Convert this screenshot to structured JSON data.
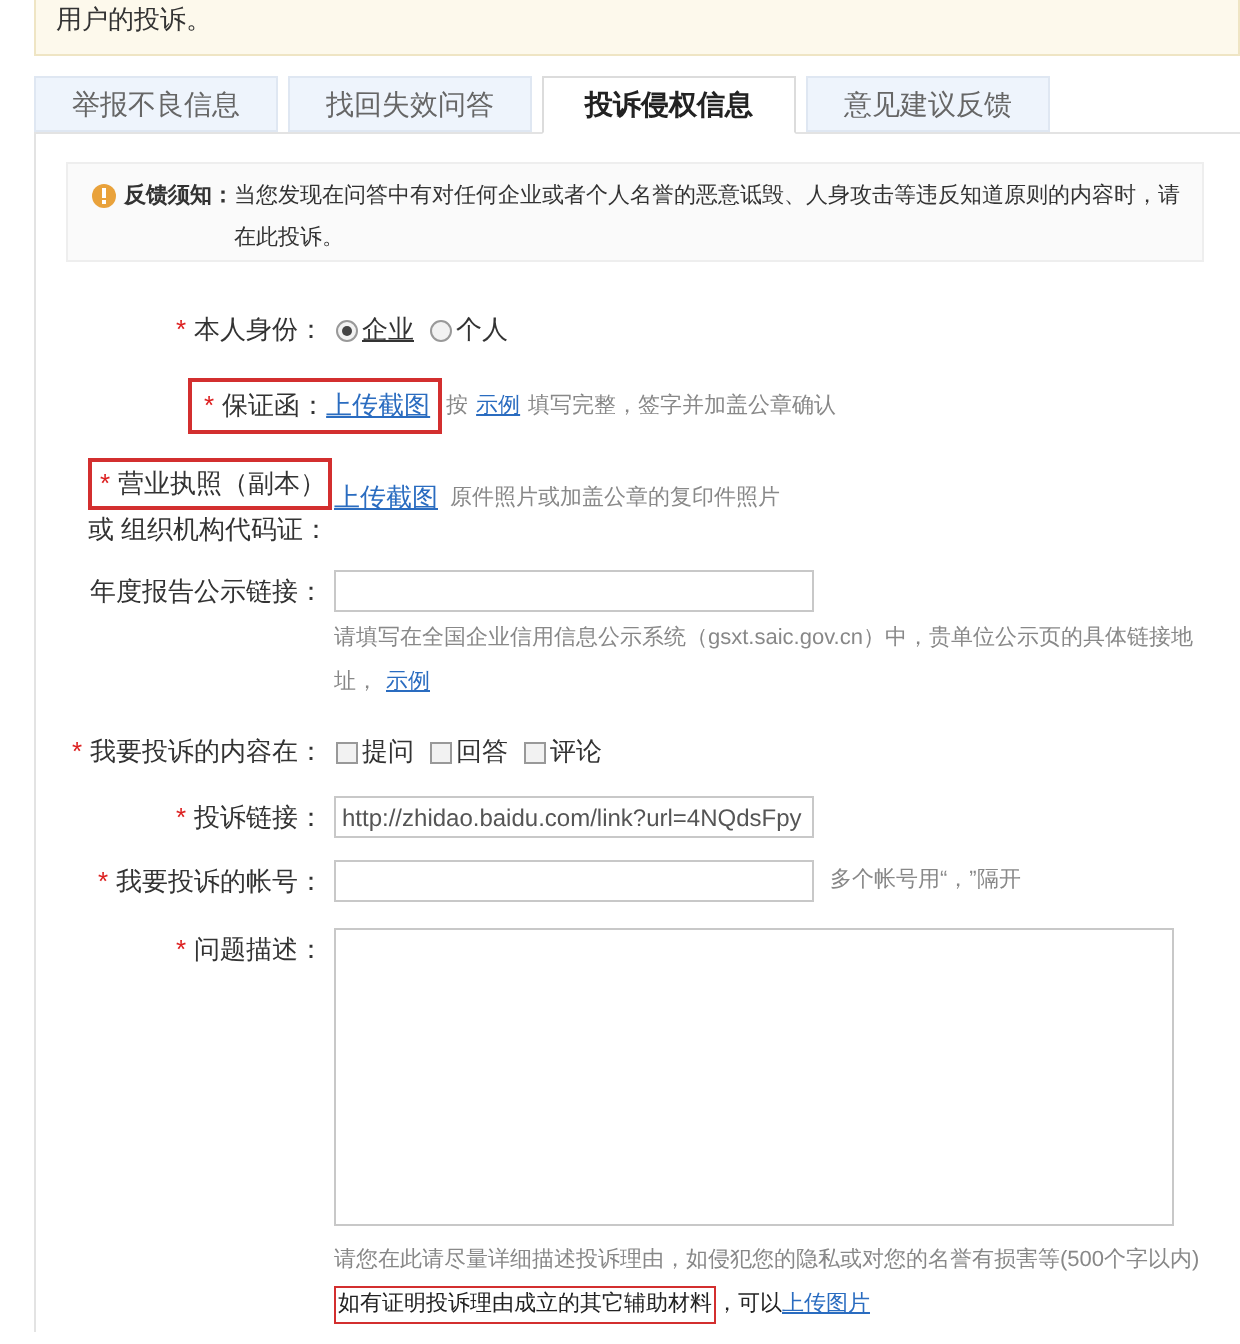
{
  "top_notice": {
    "text": "用户的投诉。"
  },
  "tabs": [
    {
      "label": "举报不良信息",
      "selected": false
    },
    {
      "label": "找回失效问答",
      "selected": false
    },
    {
      "label": "投诉侵权信息",
      "selected": true
    },
    {
      "label": "意见建议反馈",
      "selected": false
    }
  ],
  "notice": {
    "title": "反馈须知：",
    "text": "当您发现在问答中有对任何企业或者个人名誉的恶意诋毁、人身攻击等违反知道原则的内容时，请在此投诉。"
  },
  "rows": [
    {
      "kind": "radio",
      "required_mark": "*",
      "label": "本人身份：",
      "options": [
        {
          "label": "企业",
          "selected": true
        },
        {
          "label": "个人",
          "selected": false
        }
      ]
    },
    {
      "kind": "upload",
      "required_mark": "*",
      "highlighted": true,
      "label": "保证函：",
      "link": "上传截图",
      "hint": [
        {
          "kind": "text",
          "text": "按"
        },
        {
          "kind": "link",
          "text": "示例"
        },
        {
          "kind": "text",
          "text": "填写完整，签字并加盖公章确认"
        }
      ]
    },
    {
      "kind": "upload_two_line",
      "required_mark": "*",
      "highlighted": true,
      "label": "营业执照（副本）",
      "label_2": "或 组织机构代码证：",
      "link": "上传截图",
      "hint": [
        {
          "kind": "text",
          "text": "原件照片或加盖公章的复印件照片"
        }
      ]
    },
    {
      "kind": "text",
      "label": "年度报告公示链接：",
      "value": "",
      "hint": [
        {
          "kind": "text",
          "text": "请填写在全国企业信用信息公示系统（gsxt.saic.gov.cn）中，贵单位公示页的具体链接地址，"
        },
        {
          "kind": "link",
          "text": "示例"
        }
      ]
    },
    {
      "kind": "checkbox",
      "required_mark": "*",
      "label": "我要投诉的内容在：",
      "options": [
        {
          "label": "提问",
          "checked": false
        },
        {
          "label": "回答",
          "checked": false
        },
        {
          "label": "评论",
          "checked": false
        }
      ]
    },
    {
      "kind": "text",
      "required_mark": "*",
      "label": "投诉链接：",
      "value": "http://zhidao.baidu.com/link?url=4NQdsFpy"
    },
    {
      "kind": "text",
      "required_mark": "*",
      "label": "我要投诉的帐号：",
      "value": "",
      "side_hint": "多个帐号用“，”隔开"
    },
    {
      "kind": "textarea",
      "required_mark": "*",
      "label": "问题描述：",
      "value": "",
      "hint": [
        {
          "kind": "text",
          "text": "请您在此请尽量详细描述投诉理由，如侵犯您的隐私或对您的名誉有损害等(500个字以内)"
        }
      ],
      "note": {
        "highlighted": true,
        "text": "如有证明投诉理由成立的其它辅助材料",
        "text_2": "，可以",
        "link": "上传图片"
      }
    }
  ]
}
